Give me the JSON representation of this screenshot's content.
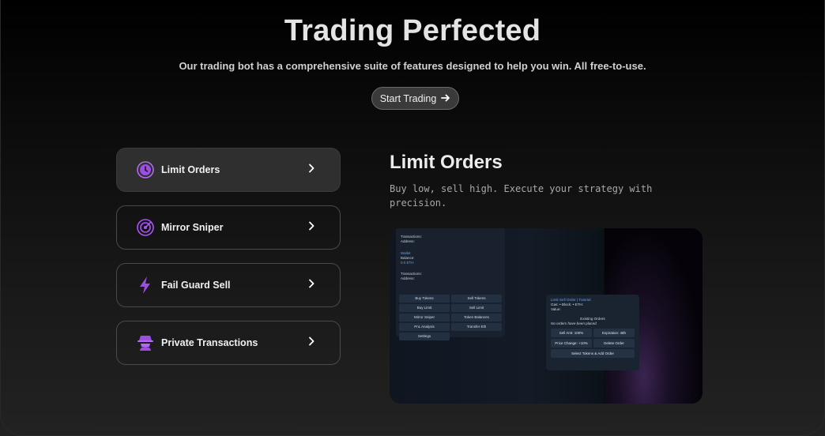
{
  "hero": {
    "title": "Trading Perfected",
    "subtitle": "Our trading bot has a comprehensive suite of features designed to help you win. All free-to-use.",
    "cta_label": "Start Trading",
    "cta_icon": "arrow-right-icon"
  },
  "features": [
    {
      "label": "Limit Orders",
      "icon": "clock-icon",
      "active": true
    },
    {
      "label": "Mirror Sniper",
      "icon": "target-icon",
      "active": false
    },
    {
      "label": "Fail Guard Sell",
      "icon": "lightning-icon",
      "active": false
    },
    {
      "label": "Private Transactions",
      "icon": "spy-icon",
      "active": false
    }
  ],
  "detail": {
    "title": "Limit Orders",
    "description": "Buy low, sell high. Execute your strategy with precision."
  },
  "preview": {
    "chat_lines": [
      "Transactions:",
      "Address:",
      "Wallet",
      "Balance:",
      "0.0 ETH",
      "Transactions:",
      "Address:"
    ],
    "chat_buttons": [
      "Buy Tokens",
      "Sell Tokens",
      "Buy Limit",
      "Sell Limit",
      "Mirror Sniper",
      "Token Balances",
      "PnL Analysis",
      "Transfer Eth",
      "Settings"
    ],
    "order_title": "Limit Sell Order | Tutorial",
    "order_info": "Gas: • Block: • ETH:",
    "order_value": "Value:",
    "order_existing": "Existing Orders",
    "order_none": "No orders have been placed",
    "order_buttons": [
      "Sell Amt: 100%",
      "Expiration: 48h",
      "Price Change: +10%",
      "Delete Order"
    ],
    "order_footer": "Select Tokens & Add Order"
  },
  "colors": {
    "accent": "#a855f7",
    "active_bg": "#2f2f2f",
    "border": "#4a4a4a"
  }
}
